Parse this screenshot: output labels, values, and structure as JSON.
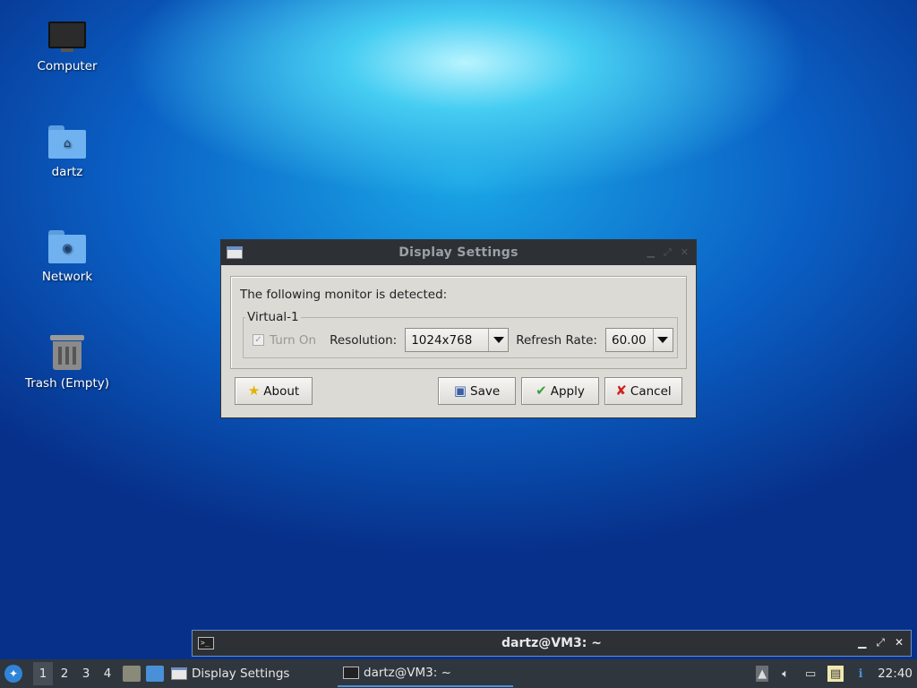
{
  "desktop": {
    "icons": [
      {
        "label": "Computer"
      },
      {
        "label": "dartz"
      },
      {
        "label": "Network"
      },
      {
        "label": "Trash (Empty)"
      }
    ]
  },
  "dialog": {
    "title": "Display Settings",
    "detected_text": "The following monitor is detected:",
    "monitor_name": "Virtual-1",
    "turn_on_label": "Turn On",
    "turn_on_checked": true,
    "resolution_label": "Resolution:",
    "resolution_value": "1024x768",
    "refresh_label": "Refresh Rate:",
    "refresh_value": "60.00",
    "buttons": {
      "about": "About",
      "save": "Save",
      "apply": "Apply",
      "cancel": "Cancel"
    }
  },
  "terminal": {
    "title": "dartz@VM3: ~"
  },
  "taskbar": {
    "workspaces": [
      "1",
      "2",
      "3",
      "4"
    ],
    "active_workspace": "1",
    "tasks": [
      {
        "label": "Display Settings"
      },
      {
        "label": "dartz@VM3: ~"
      }
    ],
    "clock": "22:40"
  },
  "colors": {
    "titlebar": "#2d3136",
    "dialog_bg": "#dcdad5",
    "taskbar": "#30363d",
    "accent": "#4a90d9"
  }
}
